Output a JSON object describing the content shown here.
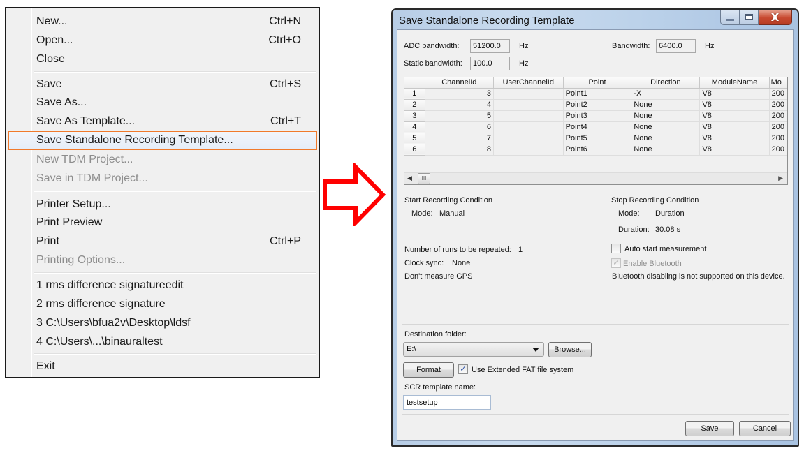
{
  "file_menu": {
    "items": [
      {
        "label": "New...",
        "shortcut": "Ctrl+N"
      },
      {
        "label": "Open...",
        "shortcut": "Ctrl+O"
      },
      {
        "label": "Close",
        "shortcut": ""
      },
      {
        "label": "Save",
        "shortcut": "Ctrl+S"
      },
      {
        "label": "Save As...",
        "shortcut": ""
      },
      {
        "label": "Save As Template...",
        "shortcut": "Ctrl+T"
      },
      {
        "label": "Save Standalone Recording Template...",
        "shortcut": ""
      },
      {
        "label": "New TDM Project...",
        "shortcut": ""
      },
      {
        "label": "Save in TDM Project...",
        "shortcut": ""
      },
      {
        "label": "Printer Setup...",
        "shortcut": ""
      },
      {
        "label": "Print Preview",
        "shortcut": ""
      },
      {
        "label": "Print",
        "shortcut": "Ctrl+P"
      },
      {
        "label": "Printing Options...",
        "shortcut": ""
      },
      {
        "label": "1 rms difference signatureedit",
        "shortcut": ""
      },
      {
        "label": "2 rms difference signature",
        "shortcut": ""
      },
      {
        "label": "3 C:\\Users\\bfua2v\\Desktop\\ldsf",
        "shortcut": ""
      },
      {
        "label": "4 C:\\Users\\...\\binauraltest",
        "shortcut": ""
      },
      {
        "label": "Exit",
        "shortcut": ""
      }
    ],
    "highlight_color": "#f07a2c"
  },
  "arrow": {
    "icon": "right-arrow-outline",
    "color": "#ff0000"
  },
  "dialog": {
    "title": "Save Standalone Recording Template",
    "window_buttons": {
      "minimize": "minimize",
      "maximize": "maximize",
      "close": "X"
    },
    "adc_bandwidth": {
      "label": "ADC bandwidth:",
      "value": "51200.0",
      "unit": "Hz"
    },
    "bandwidth": {
      "label": "Bandwidth:",
      "value": "6400.0",
      "unit": "Hz"
    },
    "static_bandwidth": {
      "label": "Static bandwidth:",
      "value": "100.0",
      "unit": "Hz"
    },
    "table": {
      "columns": [
        "",
        "ChannelId",
        "UserChannelId",
        "Point",
        "Direction",
        "ModuleName",
        "Mo"
      ],
      "rows": [
        {
          "n": "1",
          "channel": "3",
          "user": "",
          "point": "Point1",
          "direction": "-X",
          "module": "V8",
          "mo": "200"
        },
        {
          "n": "2",
          "channel": "4",
          "user": "",
          "point": "Point2",
          "direction": "None",
          "module": "V8",
          "mo": "200"
        },
        {
          "n": "3",
          "channel": "5",
          "user": "",
          "point": "Point3",
          "direction": "None",
          "module": "V8",
          "mo": "200"
        },
        {
          "n": "4",
          "channel": "6",
          "user": "",
          "point": "Point4",
          "direction": "None",
          "module": "V8",
          "mo": "200"
        },
        {
          "n": "5",
          "channel": "7",
          "user": "",
          "point": "Point5",
          "direction": "None",
          "module": "V8",
          "mo": "200"
        },
        {
          "n": "6",
          "channel": "8",
          "user": "",
          "point": "Point6",
          "direction": "None",
          "module": "V8",
          "mo": "200"
        }
      ],
      "scroll_thumb": "III"
    },
    "start_condition": {
      "heading": "Start Recording Condition",
      "mode_label": "Mode:",
      "mode_value": "Manual"
    },
    "stop_condition": {
      "heading": "Stop Recording Condition",
      "mode_label": "Mode:",
      "mode_value": "Duration",
      "duration_label": "Duration:",
      "duration_value": "30.08 s"
    },
    "runs": {
      "label": "Number of runs to be repeated:",
      "value": "1"
    },
    "clock_sync": {
      "label": "Clock sync:",
      "value": "None"
    },
    "gps": "Don't measure GPS",
    "auto_start": {
      "label": "Auto start measurement",
      "checked": false
    },
    "enable_bluetooth": {
      "label": "Enable Bluetooth",
      "checked": true,
      "disabled": true
    },
    "bluetooth_note": "Bluetooth disabling is not supported on this device.",
    "destination": {
      "label": "Destination folder:",
      "value": "E:\\",
      "browse": "Browse..."
    },
    "format_button": "Format",
    "extended_fat": {
      "label": "Use Extended FAT file system",
      "checked": true
    },
    "template_name": {
      "label": "SCR template name:",
      "value": "testsetup"
    },
    "save_button": "Save",
    "cancel_button": "Cancel"
  }
}
